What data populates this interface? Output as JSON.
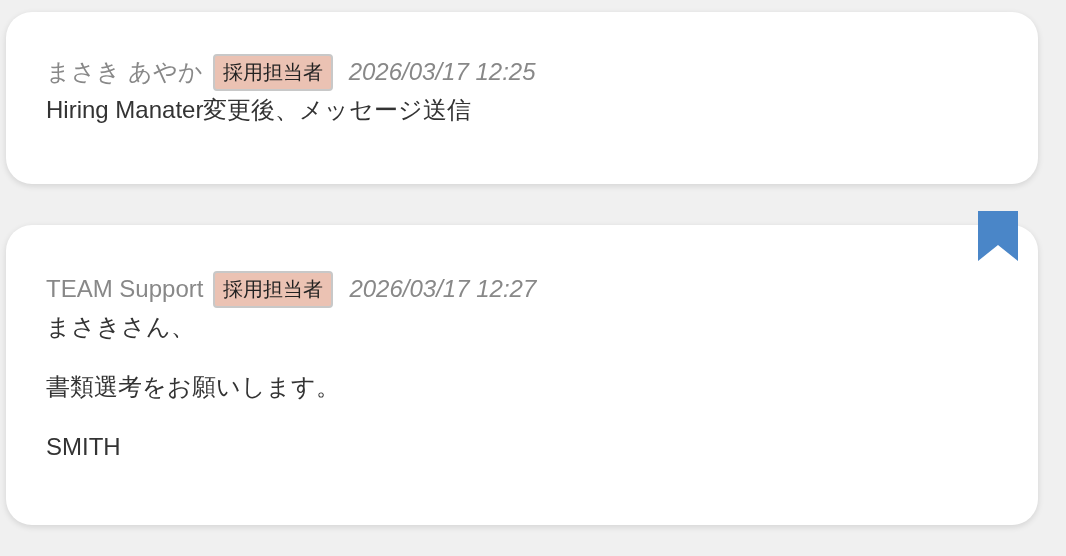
{
  "messages": [
    {
      "author": "まさき あやか",
      "role": "採用担当者",
      "timestamp": "2026/03/17 12:25",
      "bookmarked": false,
      "paragraphs": [
        "Hiring Manater変更後、メッセージ送信"
      ]
    },
    {
      "author": "TEAM Support",
      "role": "採用担当者",
      "timestamp": "2026/03/17 12:27",
      "bookmarked": true,
      "paragraphs": [
        "まさきさん、",
        "書類選考をお願いします。",
        "SMITH"
      ]
    }
  ]
}
